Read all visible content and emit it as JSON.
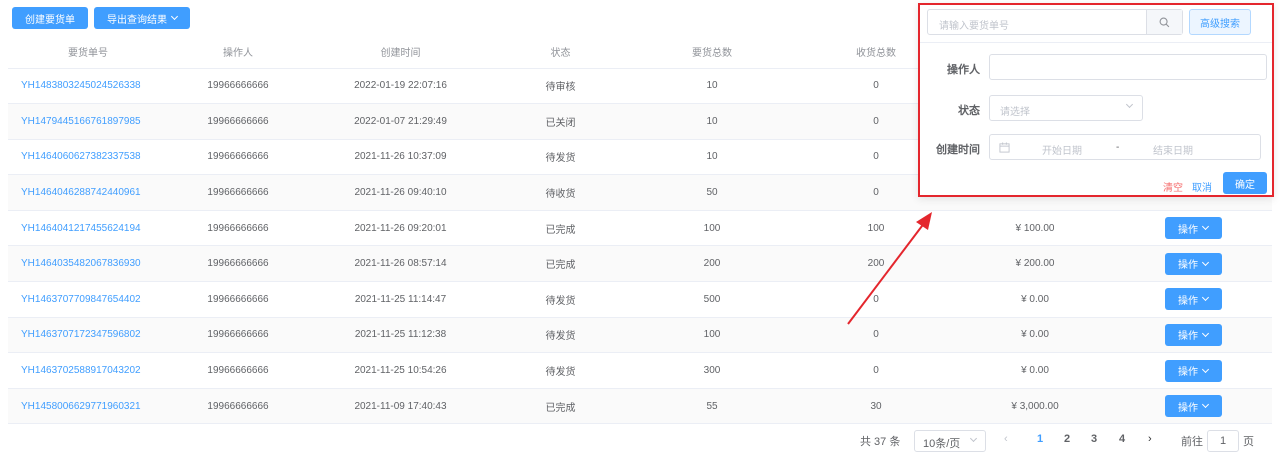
{
  "toolbar": {
    "create_label": "创建要货单",
    "export_label": "导出查询结果"
  },
  "columns": [
    "要货单号",
    "操作人",
    "创建时间",
    "状态",
    "要货总数",
    "收货总数"
  ],
  "rows": [
    {
      "id": "YH1483803245024526338",
      "operator": "19966666666",
      "time": "2022-01-19 22:07:16",
      "status": "待审核",
      "req": "10",
      "recv": "0",
      "amount": "",
      "op": ""
    },
    {
      "id": "YH1479445166761897985",
      "operator": "19966666666",
      "time": "2022-01-07 21:29:49",
      "status": "已关闭",
      "req": "10",
      "recv": "0",
      "amount": "",
      "op": ""
    },
    {
      "id": "YH1464060627382337538",
      "operator": "19966666666",
      "time": "2021-11-26 10:37:09",
      "status": "待发货",
      "req": "10",
      "recv": "0",
      "amount": "",
      "op": ""
    },
    {
      "id": "YH1464046288742440961",
      "operator": "19966666666",
      "time": "2021-11-26 09:40:10",
      "status": "待收货",
      "req": "50",
      "recv": "0",
      "amount": "",
      "op": ""
    },
    {
      "id": "YH1464041217455624194",
      "operator": "19966666666",
      "time": "2021-11-26 09:20:01",
      "status": "已完成",
      "req": "100",
      "recv": "100",
      "amount": "¥ 100.00",
      "op": "操作"
    },
    {
      "id": "YH1464035482067836930",
      "operator": "19966666666",
      "time": "2021-11-26 08:57:14",
      "status": "已完成",
      "req": "200",
      "recv": "200",
      "amount": "¥ 200.00",
      "op": "操作"
    },
    {
      "id": "YH1463707709847654402",
      "operator": "19966666666",
      "time": "2021-11-25 11:14:47",
      "status": "待发货",
      "req": "500",
      "recv": "0",
      "amount": "¥ 0.00",
      "op": "操作"
    },
    {
      "id": "YH1463707172347596802",
      "operator": "19966666666",
      "time": "2021-11-25 11:12:38",
      "status": "待发货",
      "req": "100",
      "recv": "0",
      "amount": "¥ 0.00",
      "op": "操作"
    },
    {
      "id": "YH1463702588917043202",
      "operator": "19966666666",
      "time": "2021-11-25 10:54:26",
      "status": "待发货",
      "req": "300",
      "recv": "0",
      "amount": "¥ 0.00",
      "op": "操作"
    },
    {
      "id": "YH1458006629771960321",
      "operator": "19966666666",
      "time": "2021-11-09 17:40:43",
      "status": "已完成",
      "req": "55",
      "recv": "30",
      "amount": "¥ 3,000.00",
      "op": "操作"
    }
  ],
  "pagination": {
    "total_text": "共 37 条",
    "page_size": "10条/页",
    "pages": [
      "1",
      "2",
      "3",
      "4"
    ],
    "current_page": "1",
    "goto_label": "前往",
    "goto_value": "1",
    "page_suffix": "页"
  },
  "search_panel": {
    "search_placeholder": "请输入要货单号",
    "advanced_label": "高级搜索",
    "operator_label": "操作人",
    "operator_value": "",
    "status_label": "状态",
    "status_placeholder": "请选择",
    "created_label": "创建时间",
    "start_placeholder": "开始日期",
    "range_separator": "-",
    "end_placeholder": "结束日期",
    "clear_label": "清空",
    "cancel_label": "取消",
    "confirm_label": "确定"
  },
  "colors": {
    "primary": "#409eff",
    "highlight_border": "#e4262d",
    "clear_text": "#f56c6c"
  }
}
